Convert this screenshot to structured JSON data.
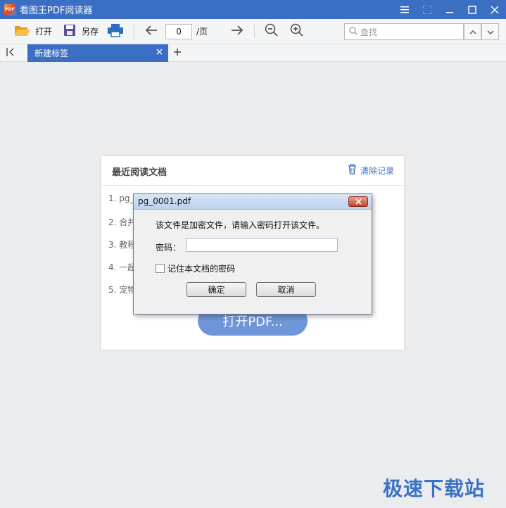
{
  "window": {
    "title": "看图王PDF阅读器",
    "logo_text": "PDF"
  },
  "toolbar": {
    "open_label": "打开",
    "save_as_label": "另存",
    "page_value": "0",
    "page_suffix": "/页",
    "search_placeholder": "查找"
  },
  "tabs": {
    "active_label": "新建标签"
  },
  "recent": {
    "title": "最近阅读文档",
    "clear_label": "清除记录",
    "items": [
      "1. pg_",
      "2. 合并",
      "3. 教程",
      "4. 一起",
      "5. 宠物"
    ],
    "open_button": "打开PDF..."
  },
  "dialog": {
    "title": "pg_0001.pdf",
    "message": "该文件是加密文件，请输入密码打开该文件。",
    "password_label": "密码：",
    "password_value": "",
    "remember_label": "记住本文档的密码",
    "ok_label": "确定",
    "cancel_label": "取消"
  },
  "watermark": "极速下载站",
  "colors": {
    "accent": "#3b6fc4",
    "button_blue": "#6f96d9",
    "background": "#ebecee"
  }
}
